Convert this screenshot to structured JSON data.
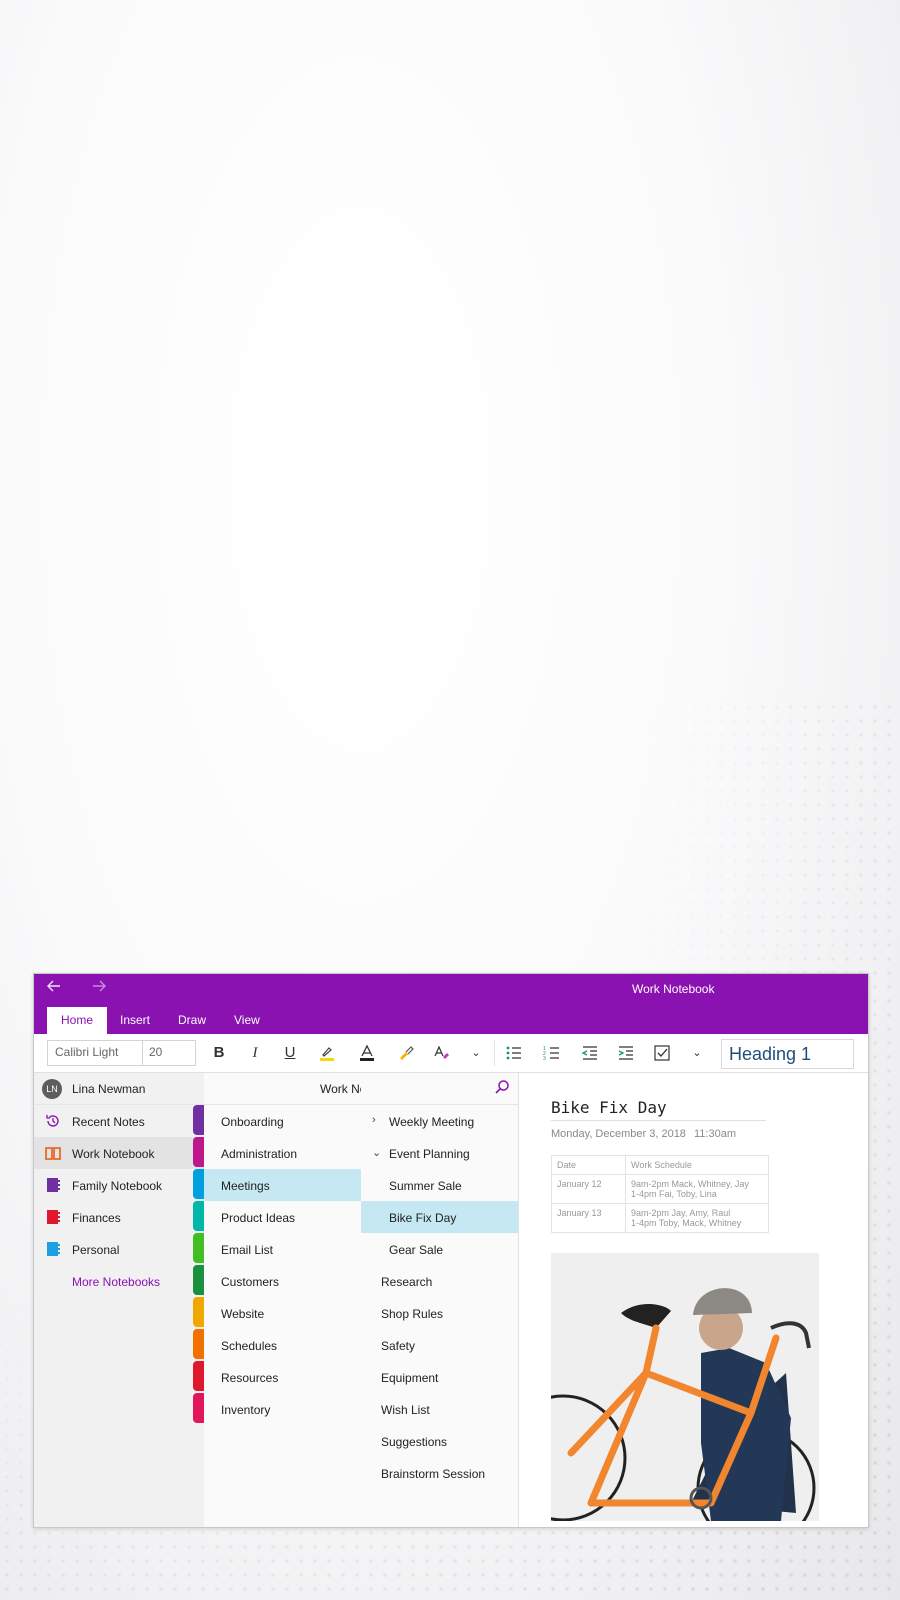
{
  "window": {
    "title": "Work Notebook",
    "back_icon": "arrow-left-icon",
    "forward_icon": "arrow-right-icon"
  },
  "tabs": [
    {
      "label": "Home",
      "active": true
    },
    {
      "label": "Insert",
      "active": false
    },
    {
      "label": "Draw",
      "active": false
    },
    {
      "label": "View",
      "active": false
    }
  ],
  "ribbon": {
    "font_name": "Calibri Light",
    "font_size": "20",
    "bold": "B",
    "italic": "I",
    "underline": "U",
    "font_color_letter": "A",
    "style_value": "Heading 1",
    "highlight_color": "#f5d90a",
    "font_color_bar": "#222222"
  },
  "user": {
    "initials": "LN",
    "name": "Lina Newman"
  },
  "notebooks": [
    {
      "label": "Recent Notes",
      "icon": "clock-icon",
      "color": "#8a12b0",
      "selected": false
    },
    {
      "label": "Work Notebook",
      "icon": "book-open-icon",
      "color": "#e8692a",
      "selected": true
    },
    {
      "label": "Family Notebook",
      "icon": "notebook-icon",
      "color": "#7030a0",
      "selected": false
    },
    {
      "label": "Finances",
      "icon": "notebook-icon",
      "color": "#e0182d",
      "selected": false
    },
    {
      "label": "Personal",
      "icon": "notebook-icon",
      "color": "#1ba1e2",
      "selected": false
    }
  ],
  "more_notebooks": "More Notebooks",
  "section_header": "Work Notebook",
  "sections": [
    {
      "label": "Onboarding",
      "color": "#7030a0"
    },
    {
      "label": "Administration",
      "color": "#c0168c"
    },
    {
      "label": "Meetings",
      "color": "#00a0e0",
      "selected": true
    },
    {
      "label": "Product Ideas",
      "color": "#00b7a8"
    },
    {
      "label": "Email List",
      "color": "#3fbf20"
    },
    {
      "label": "Customers",
      "color": "#1a8f3c"
    },
    {
      "label": "Website",
      "color": "#f0a800"
    },
    {
      "label": "Schedules",
      "color": "#f07000"
    },
    {
      "label": "Resources",
      "color": "#e0182d"
    },
    {
      "label": "Inventory",
      "color": "#e0185a"
    }
  ],
  "pages": [
    {
      "label": "Weekly Meeting",
      "chevron": "›",
      "level": 0
    },
    {
      "label": "Event Planning",
      "chevron": "⌄",
      "level": 0
    },
    {
      "label": "Summer Sale",
      "chevron": "",
      "level": 1
    },
    {
      "label": "Bike Fix Day",
      "chevron": "",
      "level": 1,
      "selected": true
    },
    {
      "label": "Gear Sale",
      "chevron": "",
      "level": 1
    },
    {
      "label": "Research",
      "chevron": "",
      "level": 0
    },
    {
      "label": "Shop Rules",
      "chevron": "",
      "level": 0
    },
    {
      "label": "Safety",
      "chevron": "",
      "level": 0
    },
    {
      "label": "Equipment",
      "chevron": "",
      "level": 0
    },
    {
      "label": "Wish List",
      "chevron": "",
      "level": 0
    },
    {
      "label": "Suggestions",
      "chevron": "",
      "level": 0
    },
    {
      "label": "Brainstorm Session",
      "chevron": "",
      "level": 0
    }
  ],
  "page": {
    "title": "Bike Fix Day",
    "date": "Monday, December 3, 2018",
    "time": "11:30am",
    "table": {
      "headers": [
        "Date",
        "Work Schedule"
      ],
      "rows": [
        [
          "January 12",
          "9am-2pm Mack, Whitney, Jay",
          "1-4pm Fai, Toby, Lina"
        ],
        [
          "January 13",
          "9am-2pm Jay, Amy, Raul",
          "1-4pm Toby, Mack, Whitney"
        ]
      ]
    },
    "image": "man-carrying-bicycle-photo"
  }
}
